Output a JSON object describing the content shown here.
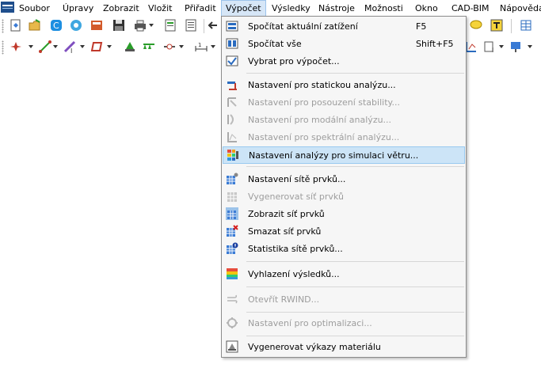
{
  "menubar": {
    "items": [
      "Soubor",
      "Úpravy",
      "Zobrazit",
      "Vložit",
      "Přiřadit",
      "Výpočet",
      "Výsledky",
      "Nástroje",
      "Možnosti",
      "Okno",
      "CAD-BIM",
      "Nápověda"
    ],
    "active_index": 5
  },
  "menu": {
    "items": [
      {
        "label": "Spočítat aktuální zatížení",
        "shortcut": "F5",
        "icon": "calc-load-icon",
        "enabled": true
      },
      {
        "label": "Spočítat vše",
        "shortcut": "Shift+F5",
        "icon": "calc-all-icon",
        "enabled": true
      },
      {
        "label": "Vybrat pro výpočet...",
        "shortcut": "",
        "icon": "select-calc-icon",
        "enabled": true
      },
      {
        "label": "Nastavení pro statickou analýzu...",
        "shortcut": "",
        "icon": "static-analysis-icon",
        "enabled": true
      },
      {
        "label": "Nastavení pro posouzení stability...",
        "shortcut": "",
        "icon": "stability-icon",
        "enabled": false
      },
      {
        "label": "Nastavení pro modální analýzu...",
        "shortcut": "",
        "icon": "modal-analysis-icon",
        "enabled": false
      },
      {
        "label": "Nastavení pro spektrální analýzu...",
        "shortcut": "",
        "icon": "spectral-analysis-icon",
        "enabled": false
      },
      {
        "label": "Nastavení analýzy pro simulaci větru...",
        "shortcut": "",
        "icon": "wind-simulation-icon",
        "enabled": true,
        "highlighted": true
      },
      {
        "label": "Nastavení sítě prvků...",
        "shortcut": "",
        "icon": "mesh-settings-icon",
        "enabled": true
      },
      {
        "label": "Vygenerovat síť prvků",
        "shortcut": "",
        "icon": "generate-mesh-icon",
        "enabled": false
      },
      {
        "label": "Zobrazit síť prvků",
        "shortcut": "",
        "icon": "show-mesh-icon",
        "enabled": true
      },
      {
        "label": "Smazat síť prvků",
        "shortcut": "",
        "icon": "delete-mesh-icon",
        "enabled": true
      },
      {
        "label": "Statistika sítě prvků...",
        "shortcut": "",
        "icon": "mesh-stats-icon",
        "enabled": true
      },
      {
        "label": "Vyhlazení výsledků...",
        "shortcut": "",
        "icon": "smoothing-icon",
        "enabled": true
      },
      {
        "label": "Otevřít RWIND...",
        "shortcut": "",
        "icon": "rwind-icon",
        "enabled": false
      },
      {
        "label": "Nastavení pro optimalizaci...",
        "shortcut": "",
        "icon": "optimization-icon",
        "enabled": false
      },
      {
        "label": "Vygenerovat výkazy materiálu",
        "shortcut": "",
        "icon": "material-report-icon",
        "enabled": true
      }
    ]
  },
  "colors": {
    "menu_highlight": "#cce4f7",
    "menubar_active": "#d6e6f7",
    "disabled_text": "#9d9d9d"
  }
}
